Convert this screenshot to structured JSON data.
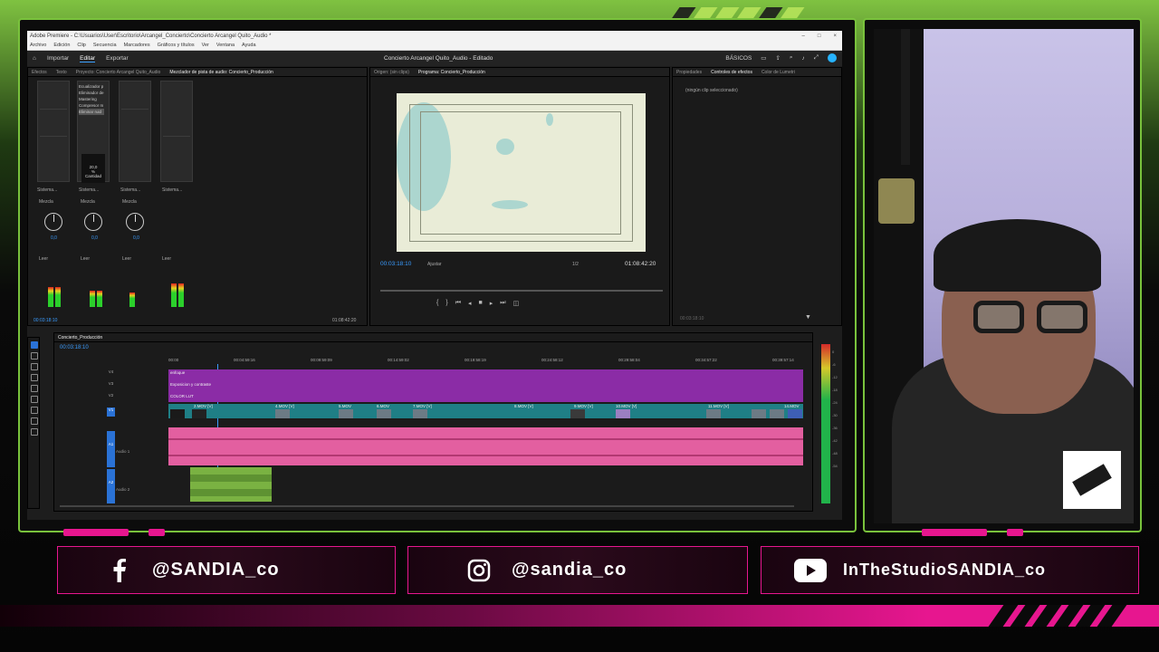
{
  "window": {
    "title": "Adobe Premiere - C:\\Usuarios\\User\\Escritorio\\Arcangel_Concierto\\Concierto Arcangel Quito_Audio *",
    "controls": [
      "–",
      "□",
      "×"
    ]
  },
  "menu": [
    "Archivo",
    "Edición",
    "Clip",
    "Secuencia",
    "Marcadores",
    "Gráficos y títulos",
    "Ver",
    "Ventana",
    "Ayuda"
  ],
  "workspaces": {
    "tabs": [
      "Importar",
      "Editar",
      "Exportar"
    ],
    "active": "Editar",
    "project_title": "Concierto Arcangel Quito_Audio - Editado",
    "basic": "BÁSICOS"
  },
  "left_panel": {
    "tabs": [
      "Efectos",
      "Texto",
      "Proyecto: Concierto Arcangel Quito_Audio",
      "Mezclador de pista de audio: Concierto_Producción"
    ],
    "effects_list": [
      "Ecualizador p",
      "Eliminador de",
      "Mastering",
      "Compresor m",
      "Eliminar ruid"
    ],
    "effect_value": "20,0",
    "effect_unit": "%",
    "effect_param": "Cantidad",
    "routing": [
      "Sistema...",
      "Sistema...",
      "Sistema...",
      "Sistema..."
    ],
    "mix": [
      "Mezcla",
      "Mezcla",
      "Mezcla"
    ],
    "pan_values": [
      "0,0",
      "0,0",
      "0,0"
    ],
    "automation": [
      "Leer",
      "Leer",
      "Leer",
      "Leer"
    ],
    "timecode_left": "00:03:18:10",
    "timecode_right": "01:08:42:20"
  },
  "monitor": {
    "tabs": [
      "Origen: (sin clips)",
      "Programa: Concierto_Producción"
    ],
    "timecode": "00:03:18:10",
    "fit": "Ajustar",
    "quality": "1/2",
    "duration": "01:08:42:20"
  },
  "right_panel": {
    "tabs": [
      "Propiedades",
      "Controles de efectos",
      "Color de Lumetri"
    ],
    "empty_text": "(ningún clip seleccionado)",
    "timecode": "00:03:18:10"
  },
  "timeline": {
    "sequence": "Concierto_Producción",
    "timecode": "00:03:18:10",
    "ruler": [
      "00:00",
      "00:04:59:16",
      "00:09:59:09",
      "00:14:59:02",
      "00:19:58:19",
      "00:24:58:12",
      "00:29:58:04",
      "00:34:57:22",
      "00:39:57:14"
    ],
    "tracks": {
      "v4": "V4",
      "v3": "V3",
      "v2": "V2",
      "v1": "V1",
      "a1": "A1",
      "a2": "A2",
      "a1_name": "Audio 1",
      "a2_name": "Audio 2"
    },
    "adjustment_layers": [
      "enfoque",
      "Exposicion y contraste",
      "COLOR LUT"
    ],
    "video_clips": [
      "2.MOV [V]",
      "4.MOV [V]",
      "5.MOV",
      "6.MOV",
      "7.MOV [V]",
      "8.MOV [V]",
      "9.MOV [V]",
      "10.MOV [V]",
      "11.MOV [V]",
      "14.MOV"
    ],
    "meter_scale": [
      "0",
      "-6",
      "-12",
      "-18",
      "-24",
      "-30",
      "-36",
      "-42",
      "-48",
      "-54"
    ]
  },
  "socials": {
    "facebook": "@SANDIA_co",
    "instagram": "@sandia_co",
    "youtube": "InTheStudioSANDIA_co"
  },
  "colors": {
    "accent_green": "#79c23c",
    "accent_pink": "#e7168f",
    "premiere_blue": "#3a9cff"
  }
}
